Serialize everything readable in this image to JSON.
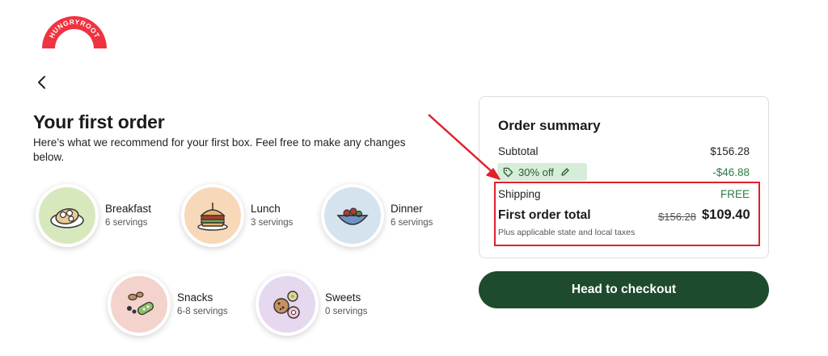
{
  "brand": {
    "logo_text": "HUNGRYROOT",
    "accent": "#ef3340"
  },
  "header": {
    "back_icon": "chevron-left-icon"
  },
  "main": {
    "title": "Your first order",
    "subtitle": "Here’s what we recommend for your first box. Feel free to make any changes below.",
    "categories": [
      {
        "name": "Breakfast",
        "servings": "6 servings",
        "bg": "#d8e8bd",
        "icon": "breakfast-food-icon"
      },
      {
        "name": "Lunch",
        "servings": "3 servings",
        "bg": "#f7d8b8",
        "icon": "sandwich-icon"
      },
      {
        "name": "Dinner",
        "servings": "6 servings",
        "bg": "#d5e3ee",
        "icon": "bowl-icon"
      },
      {
        "name": "Snacks",
        "servings": "6-8 servings",
        "bg": "#f3d3cb",
        "icon": "snacks-icon"
      },
      {
        "name": "Sweets",
        "servings": "0 servings",
        "bg": "#e5d8ef",
        "icon": "cookie-icon"
      }
    ]
  },
  "summary": {
    "title": "Order summary",
    "subtotal_label": "Subtotal",
    "subtotal_value": "$156.28",
    "promo_label": "30% off",
    "discount_value": "-$46.88",
    "shipping_label": "Shipping",
    "shipping_value": "FREE",
    "total_label": "First order total",
    "total_original": "$156.28",
    "total_value": "$109.40",
    "tax_note": "Plus applicable state and local taxes"
  },
  "checkout": {
    "label": "Head to checkout",
    "color": "#1e4a2e"
  },
  "annotation": {
    "color": "#e0202a"
  }
}
